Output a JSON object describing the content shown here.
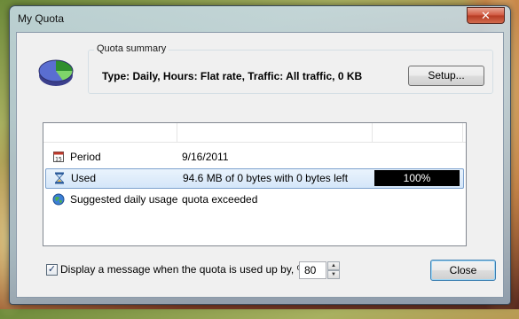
{
  "window": {
    "title": "My Quota",
    "close_glyph": "✕"
  },
  "summary": {
    "legend": "Quota summary",
    "text": "Type: Daily, Hours: Flat rate, Traffic: All traffic, 0 KB",
    "setup_label": "Setup..."
  },
  "list": {
    "rows": [
      {
        "icon": "calendar-icon",
        "name": "Period",
        "value": "9/16/2011"
      },
      {
        "icon": "hourglass-icon",
        "name": "Used",
        "value": "94.6 MB of 0 bytes with 0 bytes left",
        "progress_text": "100%",
        "progress": 1.0
      },
      {
        "icon": "globe-icon",
        "name": "Suggested daily usage",
        "value": "quota exceeded"
      }
    ]
  },
  "footer": {
    "checkbox_label": "Display a message when the quota is used up by, %",
    "checkbox_checked": true,
    "percent_value": "80",
    "close_label": "Close"
  }
}
